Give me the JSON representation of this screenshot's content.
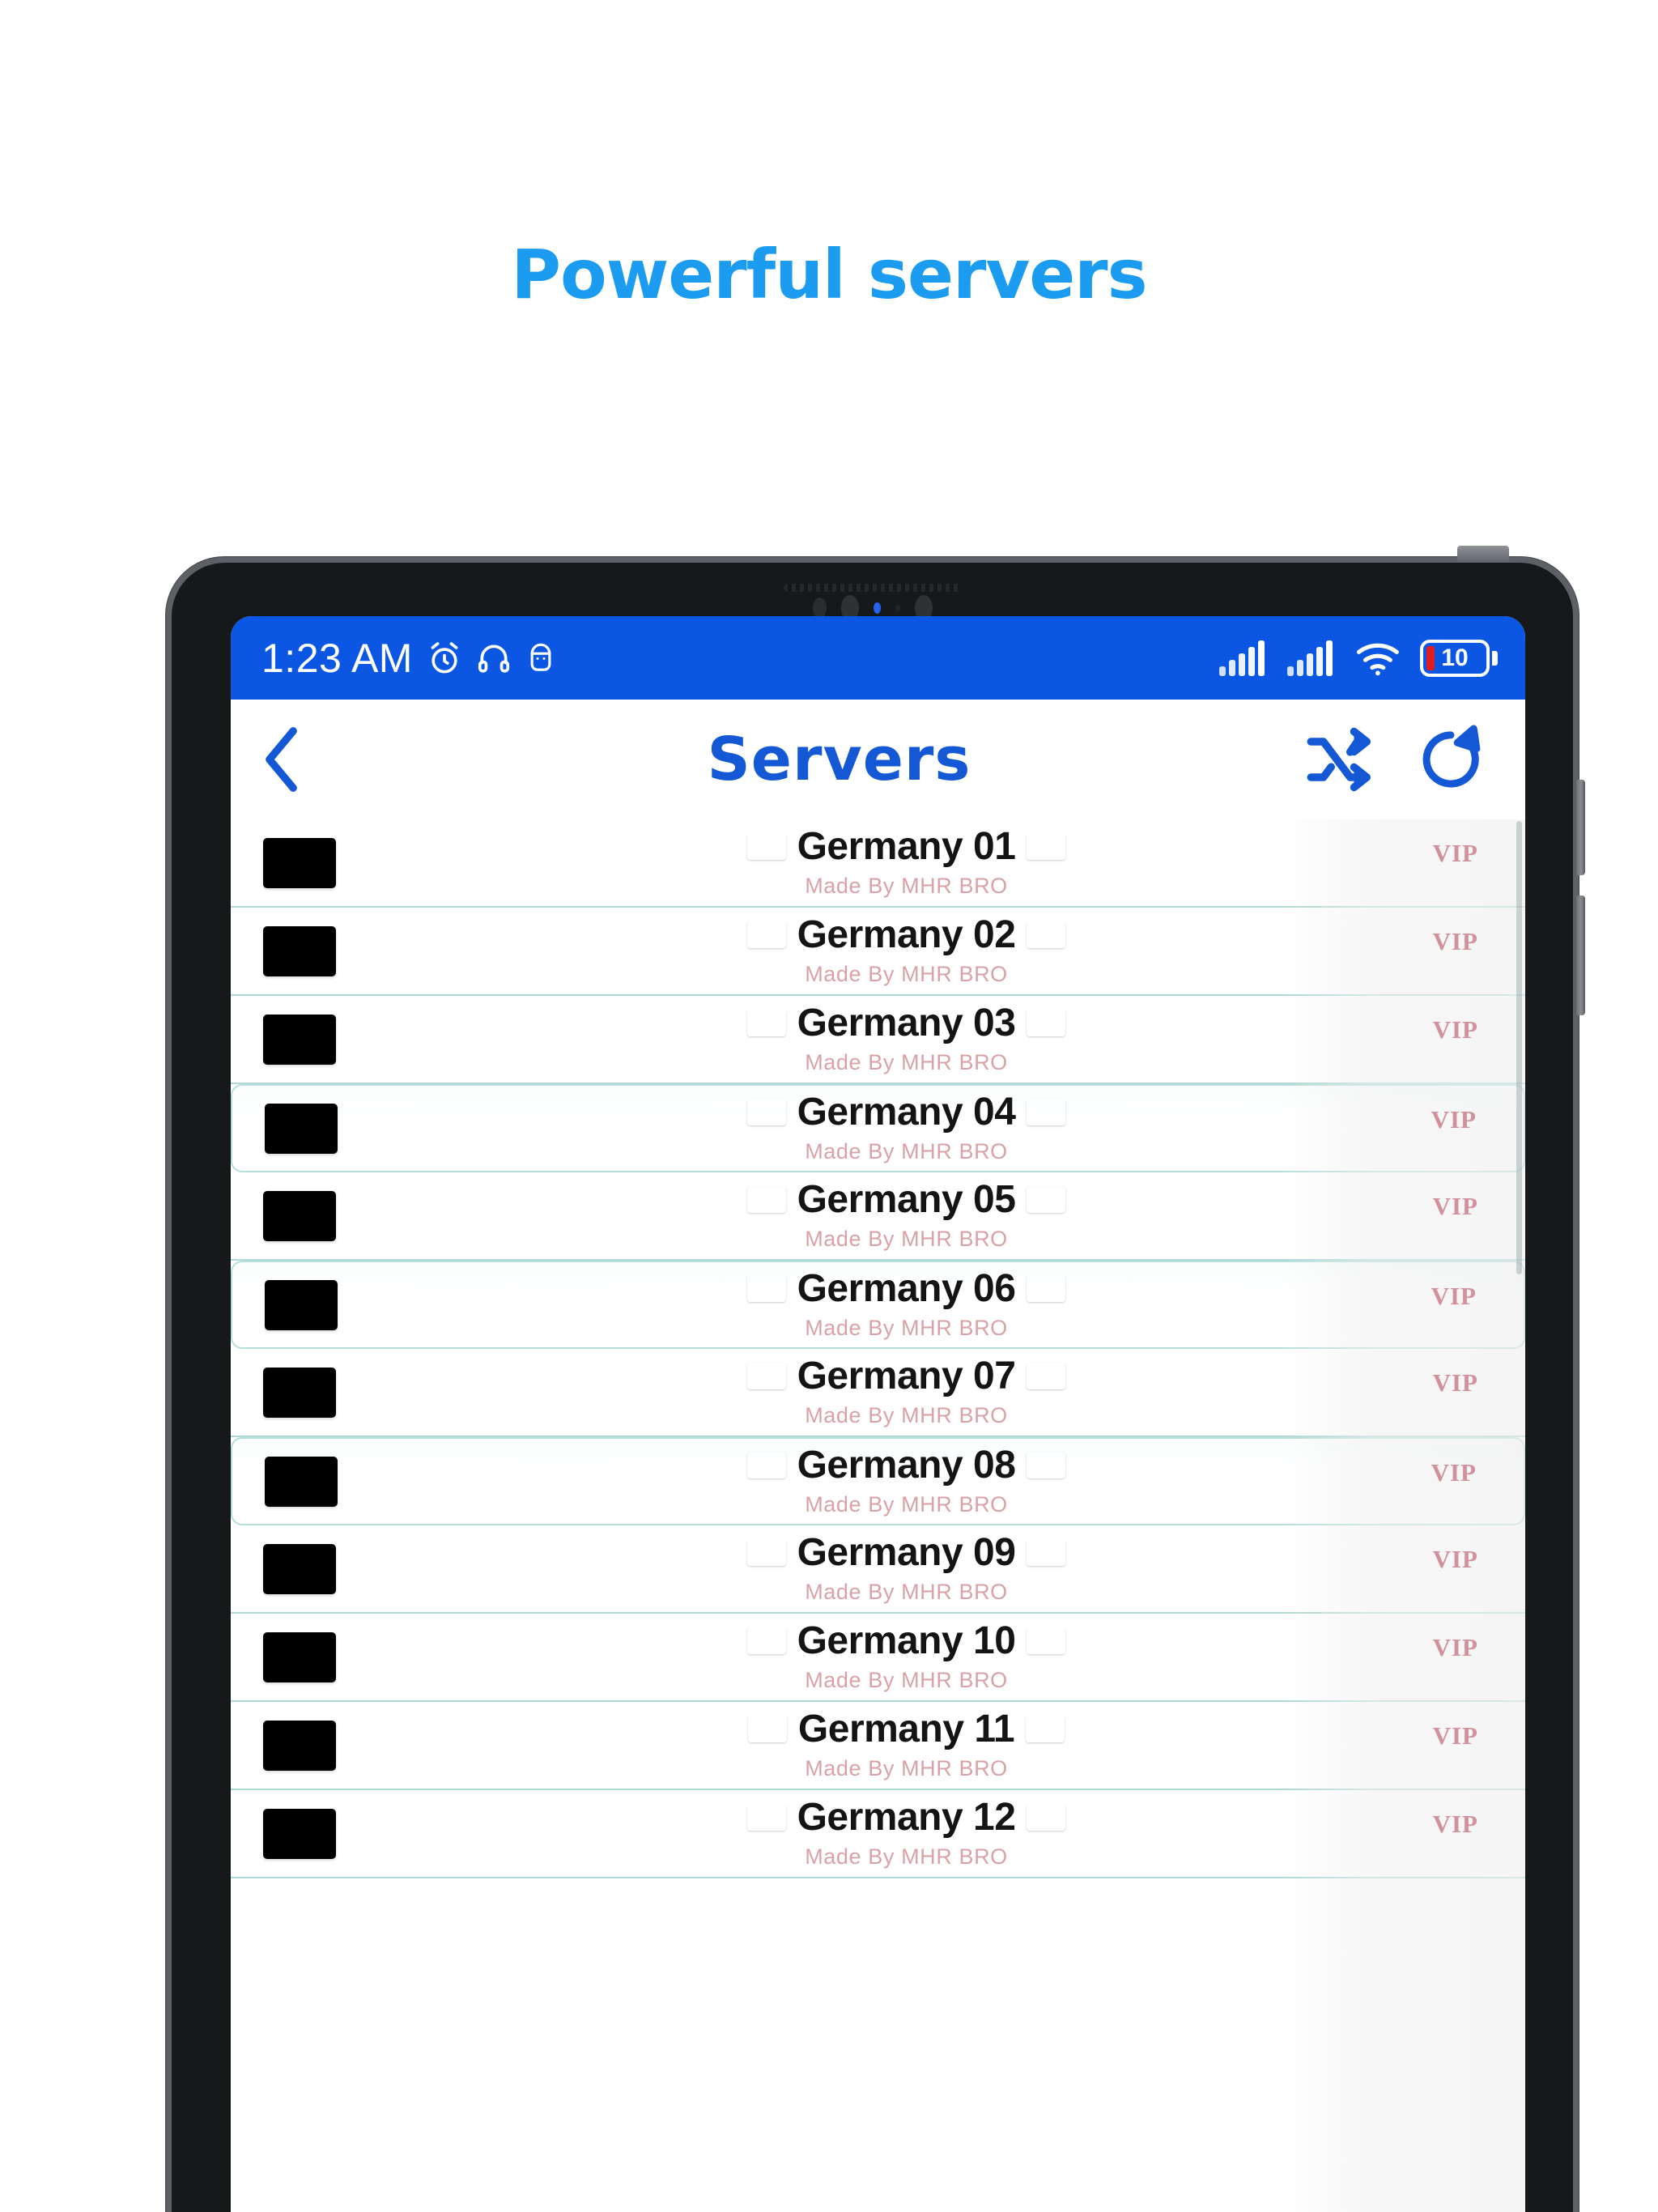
{
  "promo": {
    "heading": "Powerful servers"
  },
  "device": {
    "icons": {
      "camera": "camera-icon",
      "speaker": "speaker-grille-icon",
      "side_buttons": "volume-power-buttons"
    }
  },
  "statusbar": {
    "time": "1:23 AM",
    "left_icons": [
      "alarm-clock-icon",
      "headphones-icon",
      "android-debug-icon"
    ],
    "right_icons": [
      "signal-bars-icon-1",
      "signal-bars-icon-2",
      "wifi-icon"
    ],
    "battery": {
      "level": "10",
      "color": "#E11B22"
    },
    "background": "#0B57E3"
  },
  "appbar": {
    "back": "back-chevron-icon",
    "title": "Servers",
    "shuffle": "shuffle-icon",
    "refresh": "refresh-icon",
    "title_color": "#1558D6"
  },
  "list": {
    "vip_label": "VIP",
    "subtitle": "Made By MHR BRO",
    "flag": "german-flag-icon",
    "rows": [
      {
        "name": "Germany 01",
        "vip": "VIP",
        "subtitle": "Made By MHR BRO",
        "highlight": false
      },
      {
        "name": "Germany 02",
        "vip": "VIP",
        "subtitle": "Made By MHR BRO",
        "highlight": false
      },
      {
        "name": "Germany 03",
        "vip": "VIP",
        "subtitle": "Made By MHR BRO",
        "highlight": false
      },
      {
        "name": "Germany 04",
        "vip": "VIP",
        "subtitle": "Made By MHR BRO",
        "highlight": true
      },
      {
        "name": "Germany 05",
        "vip": "VIP",
        "subtitle": "Made By MHR BRO",
        "highlight": false
      },
      {
        "name": "Germany 06",
        "vip": "VIP",
        "subtitle": "Made By MHR BRO",
        "highlight": true
      },
      {
        "name": "Germany 07",
        "vip": "VIP",
        "subtitle": "Made By MHR BRO",
        "highlight": false
      },
      {
        "name": "Germany 08",
        "vip": "VIP",
        "subtitle": "Made By MHR BRO",
        "highlight": true
      },
      {
        "name": "Germany 09",
        "vip": "VIP",
        "subtitle": "Made By MHR BRO",
        "highlight": false
      },
      {
        "name": "Germany 10",
        "vip": "VIP",
        "subtitle": "Made By MHR BRO",
        "highlight": false
      },
      {
        "name": "Germany 11",
        "vip": "VIP",
        "subtitle": "Made By MHR BRO",
        "highlight": false
      },
      {
        "name": "Germany 12",
        "vip": "VIP",
        "subtitle": "Made By MHR BRO",
        "highlight": false
      }
    ]
  },
  "colors": {
    "promo_blue": "#1C9CF0",
    "status_blue": "#0B57E3",
    "accent_blue": "#1558D6",
    "vip_red": "#A8112C",
    "subtitle_rose": "#D9A2A6",
    "divider_teal": "#AFD9D6"
  }
}
